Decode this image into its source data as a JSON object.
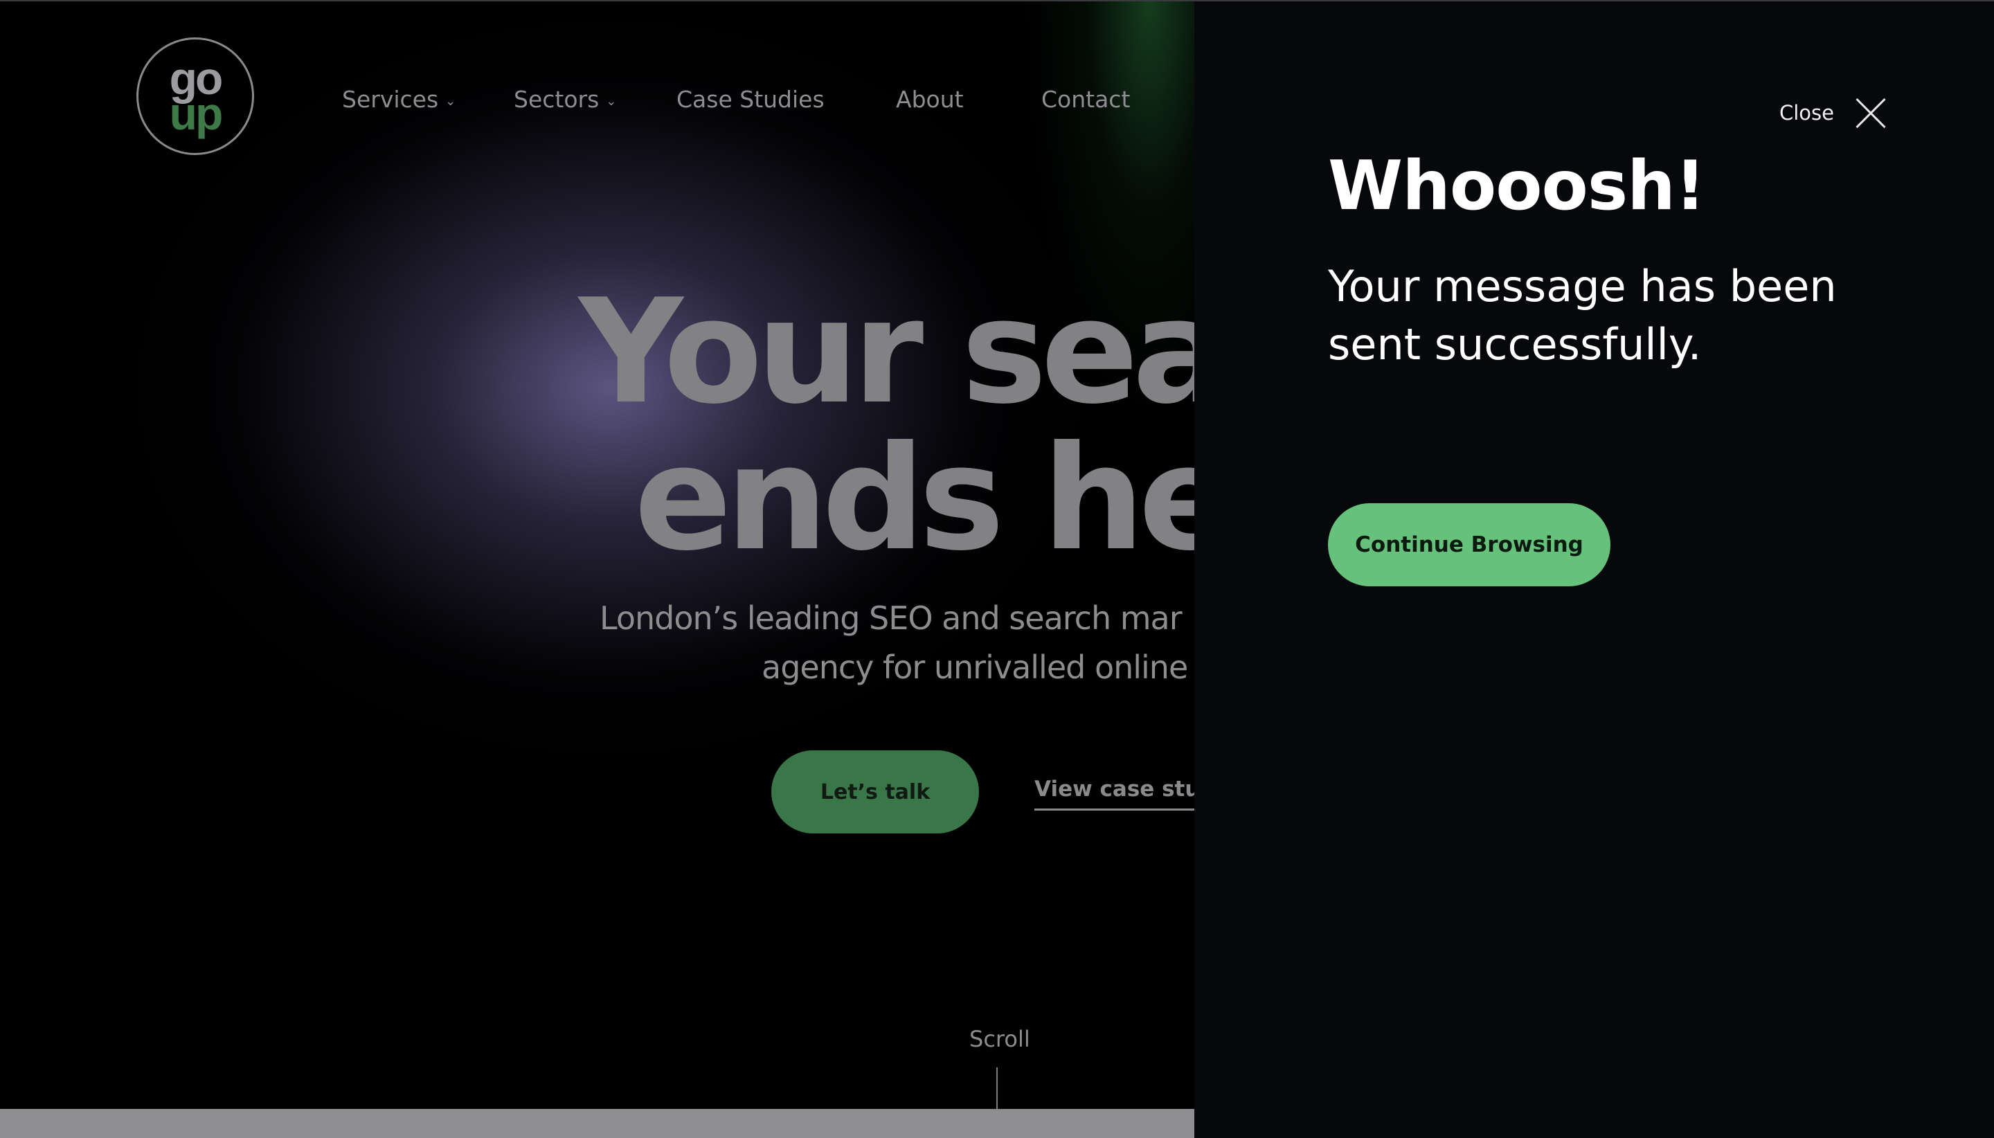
{
  "logo": {
    "line1": "go",
    "line2": "up"
  },
  "nav": {
    "items": [
      {
        "label": "Services",
        "has_dropdown": true
      },
      {
        "label": "Sectors",
        "has_dropdown": true
      },
      {
        "label": "Case Studies",
        "has_dropdown": false
      },
      {
        "label": "About",
        "has_dropdown": false
      },
      {
        "label": "Contact",
        "has_dropdown": false
      }
    ],
    "chevron": "⌄"
  },
  "hero": {
    "line1": "Your sea",
    "line2": "ends he",
    "sub1": "London’s leading SEO and search mar",
    "sub2": "agency for unrivalled online",
    "primary_cta": "Let’s talk",
    "secondary_cta": "View case stud",
    "scroll_label": "Scroll"
  },
  "modal": {
    "close_label": "Close",
    "title": "Whooosh!",
    "message": "Your message has been sent successfully.",
    "button": "Continue Browsing"
  },
  "colors": {
    "accent_green": "#66c27b",
    "dim_green": "#3a7748",
    "panel_bg": "#07080c"
  }
}
